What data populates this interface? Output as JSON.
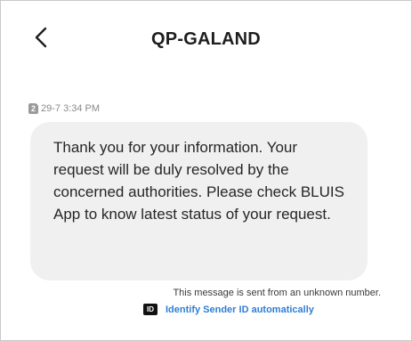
{
  "header": {
    "title": "QP-GALAND"
  },
  "message": {
    "sim_slot": "2",
    "timestamp": "29-7 3:34 PM",
    "text": "Thank you for your information. Your request will be duly resolved by the concerned authorities. Please check BLUIS App to know latest status of your request."
  },
  "footer": {
    "notice": "This message is sent from an unknown number.",
    "id_icon_label": "ID",
    "identify_link": "Identify Sender ID automatically"
  },
  "colors": {
    "link": "#2f7ed8",
    "bubble": "#f0f0f0",
    "meta_text": "#8a8a8a"
  },
  "icons": {
    "back": "chevron-left-icon",
    "sim": "sim-card-icon",
    "id": "id-badge-icon"
  }
}
